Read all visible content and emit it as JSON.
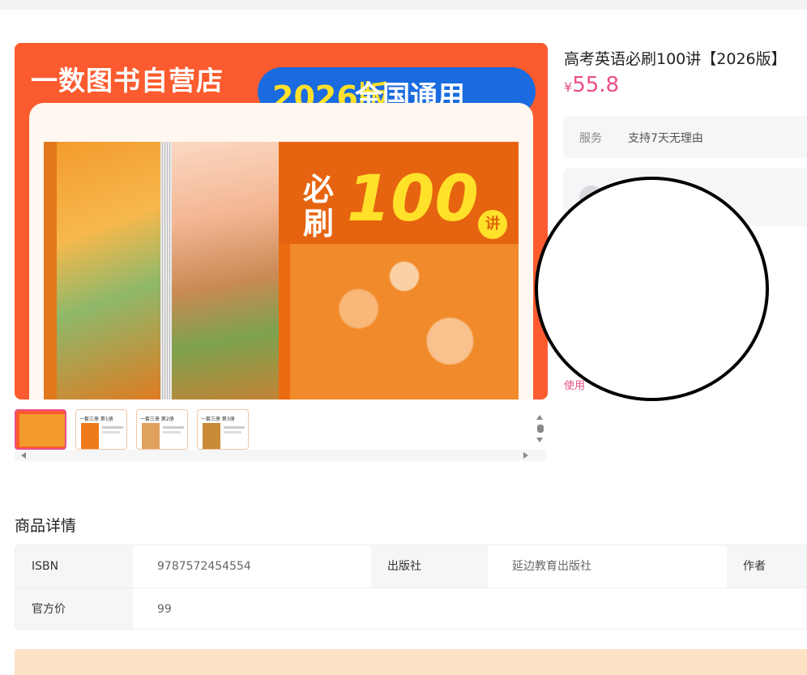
{
  "main_image": {
    "store_name": "一数图书自营店",
    "edition_year": "2026版",
    "edition_text": "全国通用",
    "cover_title_a": "必刷",
    "cover_title_b": "100",
    "cover_title_c": "讲"
  },
  "thumbnails": [
    {
      "label": ""
    },
    {
      "label": "一套三册 第1册"
    },
    {
      "label": "一套三册 第2册"
    },
    {
      "label": "一套三册 第3册"
    }
  ],
  "product": {
    "title": "高考英语必刷100讲【2026版】",
    "currency": "¥",
    "price": "55.8"
  },
  "service": {
    "label": "服务",
    "value": "支持7天无理由"
  },
  "shop": {
    "name_fragment": "店",
    "rate_fragment": "%"
  },
  "use_link": "使用",
  "details": {
    "title": "商品详情",
    "rows": [
      [
        {
          "key": "ISBN",
          "value": "9787572454554"
        },
        {
          "key": "出版社",
          "value": "延边教育出版社"
        },
        {
          "key": "作者",
          "value": ""
        }
      ],
      [
        {
          "key": "官方价",
          "value": "99"
        }
      ]
    ]
  },
  "colors": {
    "accent_pink": "#e94e8a",
    "cover_orange": "#fb5b2e",
    "promo_bg": "#fde2c6"
  }
}
